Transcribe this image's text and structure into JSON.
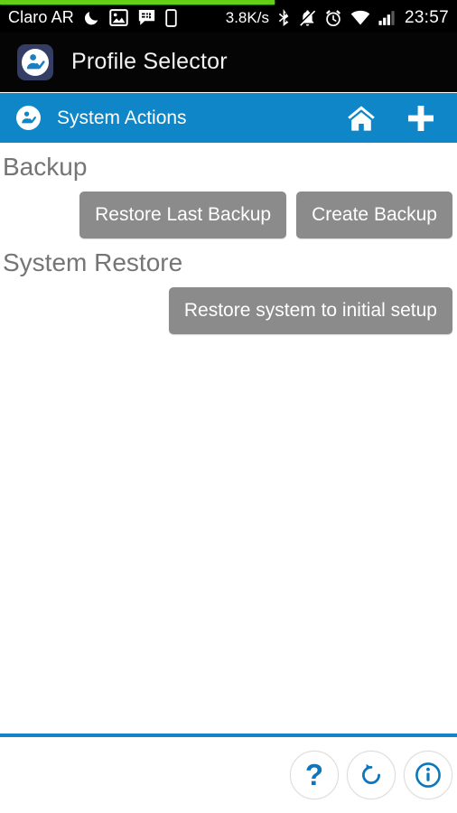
{
  "statusbar": {
    "carrier": "Claro AR",
    "network_speed": "3.8K/s",
    "clock": "23:57",
    "left_icons": [
      "moon-icon",
      "gallery-icon",
      "bbm-chat-icon",
      "vibrate-phone-icon"
    ],
    "right_icons": [
      "bluetooth-icon",
      "notifications-muted-icon",
      "alarm-clock-icon",
      "wifi-icon",
      "signal-bars-icon"
    ],
    "progress_percent": 60,
    "progress_color": "#64cf17",
    "background_color": "#000000"
  },
  "titlebar": {
    "app_name": "Profile Selector",
    "icon_name": "profile-selector-app-icon",
    "background_color": "#050505",
    "icon_background_color": "#343d63"
  },
  "actionbar": {
    "title": "System Actions",
    "logo_name": "profile-selector-logo",
    "background_color": "#0e86c8",
    "actions": [
      {
        "name": "home-icon",
        "label": "Home"
      },
      {
        "name": "plus-icon",
        "label": "Add"
      }
    ]
  },
  "content": {
    "sections": [
      {
        "heading": "Backup",
        "buttons": [
          {
            "label": "Restore Last Backup"
          },
          {
            "label": "Create Backup"
          }
        ]
      },
      {
        "heading": "System Restore",
        "buttons": [
          {
            "label": "Restore system to initial setup"
          }
        ]
      }
    ],
    "button_color": "#8b8b8b",
    "heading_color": "#757575",
    "background_color": "#ffffff"
  },
  "bottombar": {
    "divider_color": "#1484c8",
    "accent_color": "#0e77bb",
    "buttons": [
      {
        "name": "help-button",
        "glyph": "?",
        "label": "Help"
      },
      {
        "name": "refresh-button",
        "glyph": "",
        "label": "Refresh"
      },
      {
        "name": "info-button",
        "glyph": "",
        "label": "Info"
      }
    ]
  }
}
